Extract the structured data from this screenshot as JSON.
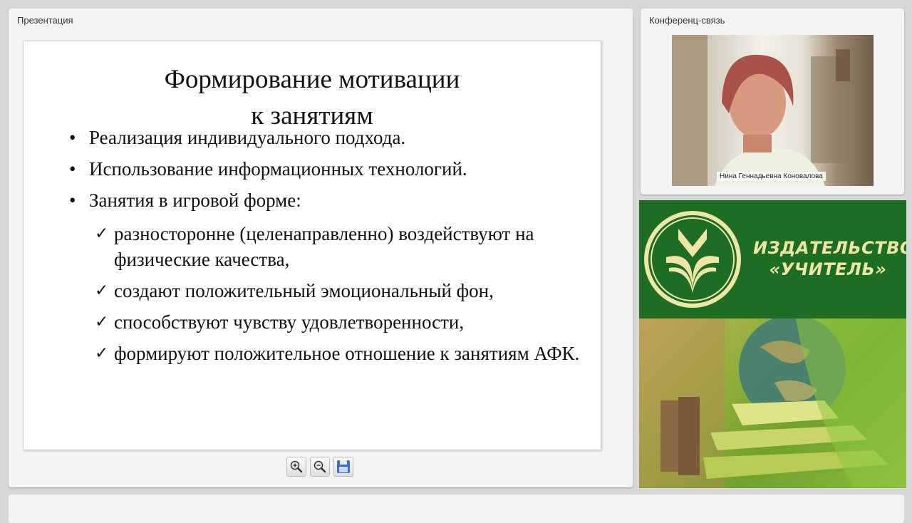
{
  "presentation": {
    "title": "Презентация",
    "slide": {
      "title_line1": "Формирование мотивации",
      "title_line2": "к занятиям",
      "bullets": [
        "Реализация индивидуального подхода.",
        "Использование информационных технологий.",
        "Занятия в игровой форме:"
      ],
      "subbullets": [
        "разносторонне (целенаправленно) воздействуют на физические качества,",
        "создают положительный эмоциональный фон,",
        "способствуют чувству удовлетворенности,",
        "формируют положительное отношение   к занятиям АФК."
      ],
      "bullet_glyph": "•",
      "check_glyph": "✓"
    },
    "toolbar": {
      "zoom_in_icon": "zoom-in-icon",
      "zoom_out_icon": "zoom-out-icon",
      "save_icon": "floppy-save-icon"
    }
  },
  "conference": {
    "title": "Конференц-связь",
    "speaker_name": "Нина Геннадьевна Коновалова"
  },
  "banner": {
    "publisher_line1": "ИЗДАТЕЛЬСТВО",
    "publisher_line2": "«УЧИТЕЛЬ»",
    "logo_icon": "book-emblem-icon"
  },
  "colors": {
    "banner_green": "#1d6d25",
    "publisher_text": "#ede6a6",
    "background": "#d7d7d7"
  }
}
